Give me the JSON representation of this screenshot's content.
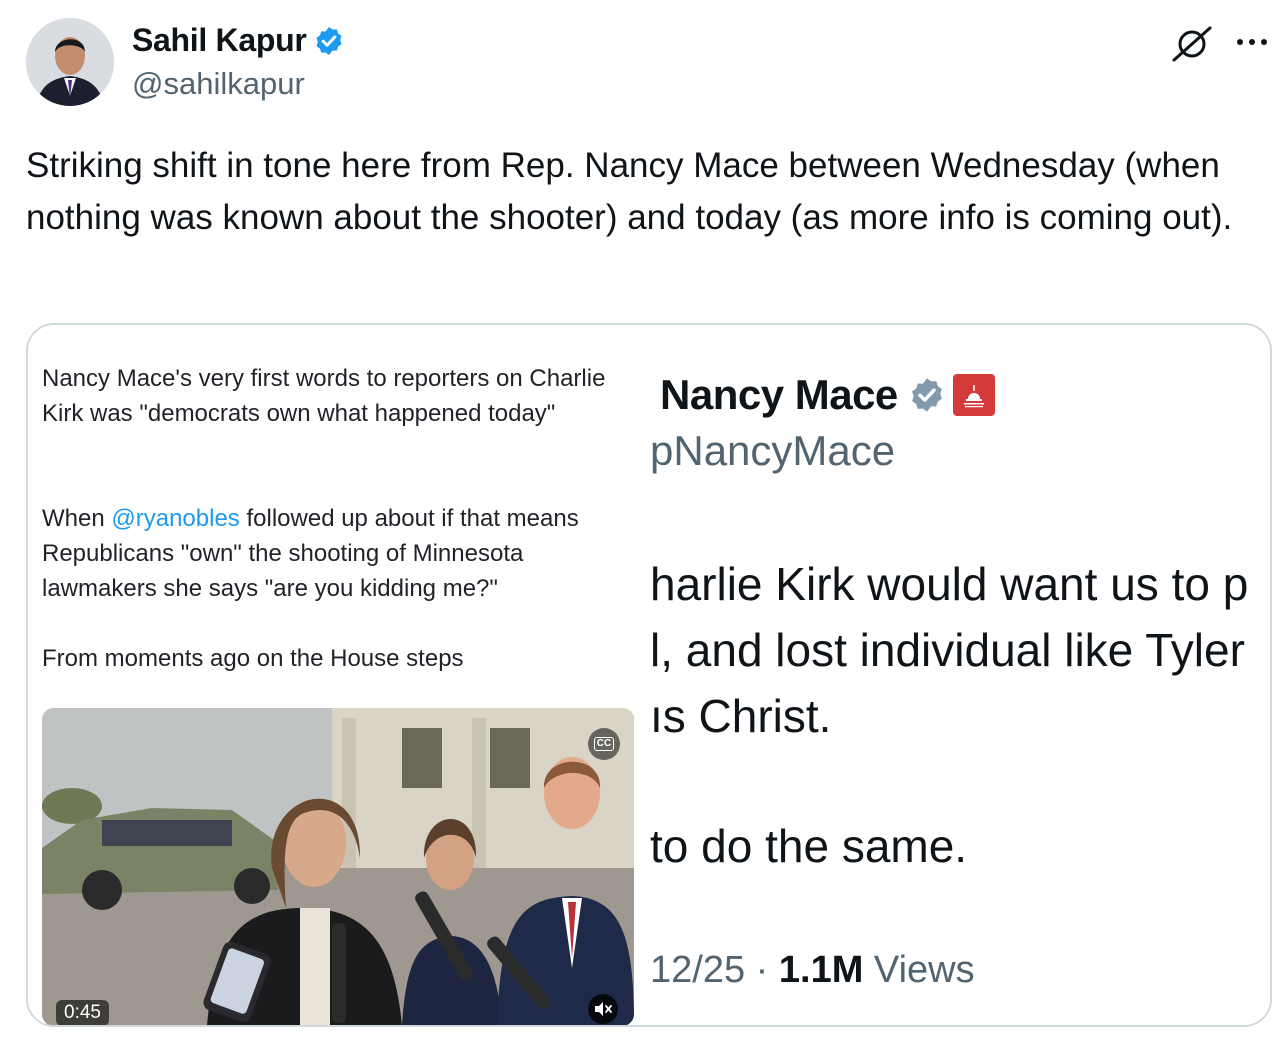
{
  "author": {
    "display_name": "Sahil Kapur",
    "handle": "@sahilkapur"
  },
  "tweet": {
    "text": "Striking shift in tone here from Rep. Nancy Mace between Wednesday (when nothing was known about the shooter) and today (as more info is coming out)."
  },
  "media_left": {
    "para1": "Nancy Mace's very first words to reporters on Charlie Kirk was \"democrats own what happened today\"",
    "para2_before": "When ",
    "para2_mention": "@ryanobles",
    "para2_after": " followed up about if that means Republicans \"own\" the shooting of Minnesota lawmakers she says \"are you kidding me?\"",
    "para3": "From moments ago on the House steps",
    "video": {
      "duration": "0:45",
      "cc_label": "CC"
    }
  },
  "media_right": {
    "name": "Nancy Mace",
    "handle": "pNancyMace",
    "line1": "harlie Kirk would want us to p",
    "line2": "l, and lost individual like Tyler",
    "line3": "ıs Christ.",
    "line4": "to do the same.",
    "date_fragment": "12/25",
    "separator": " · ",
    "views_count": "1.1M",
    "views_label": " Views"
  },
  "colors": {
    "verified_blue": "#1d9bf0",
    "verified_grey": "#829aab",
    "gop_red": "#d43a3a",
    "secondary_text": "#536471"
  }
}
